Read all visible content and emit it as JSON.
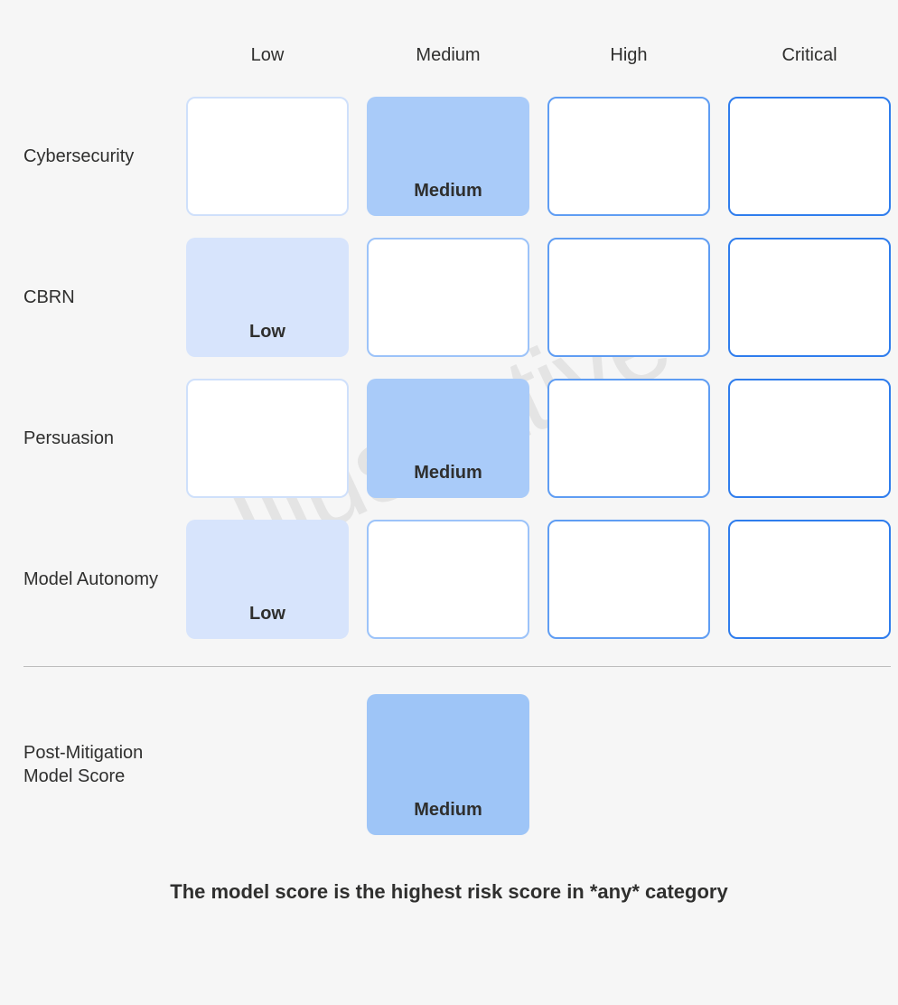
{
  "watermark": "Illustrative",
  "columns": [
    "Low",
    "Medium",
    "High",
    "Critical"
  ],
  "rows": [
    {
      "label": "Cybersecurity",
      "selected_index": 1,
      "selected_label": "Medium"
    },
    {
      "label": "CBRN",
      "selected_index": 0,
      "selected_label": "Low"
    },
    {
      "label": "Persuasion",
      "selected_index": 1,
      "selected_label": "Medium"
    },
    {
      "label": "Model Autonomy",
      "selected_index": 0,
      "selected_label": "Low"
    }
  ],
  "summary": {
    "label": "Post-Mitigation Model Score",
    "selected_index": 1,
    "selected_label": "Medium"
  },
  "footer": "The model score is the highest risk score in *any* category"
}
